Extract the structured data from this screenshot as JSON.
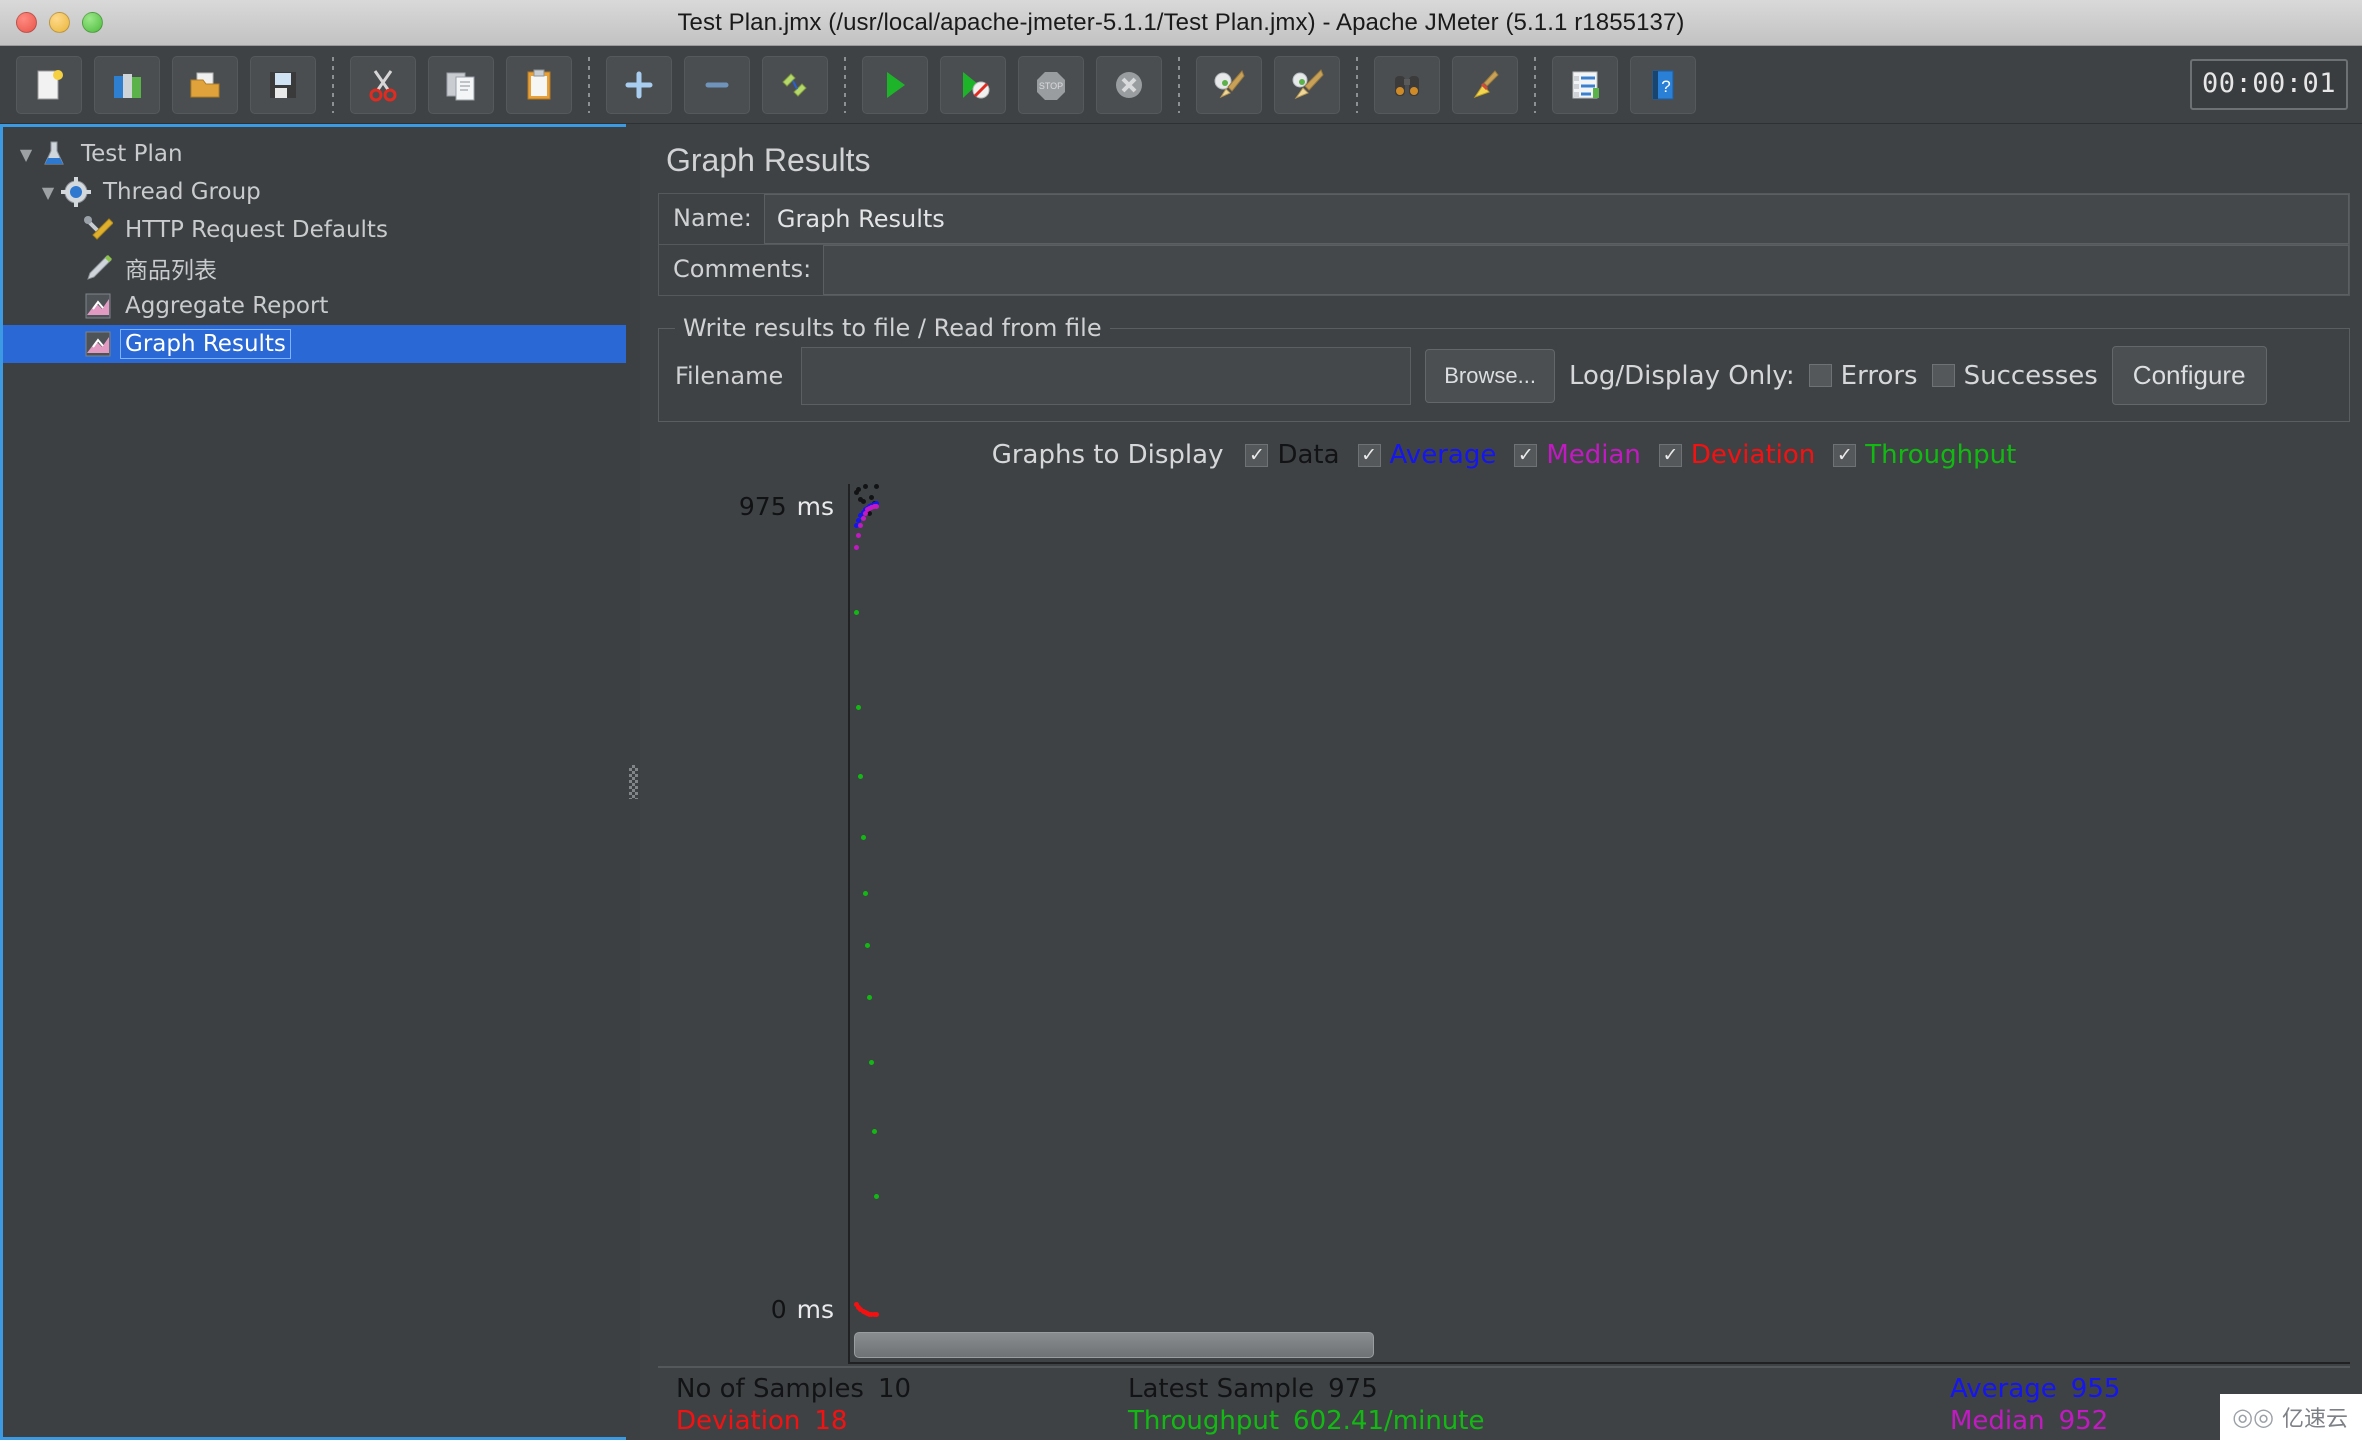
{
  "window": {
    "title": "Test Plan.jmx (/usr/local/apache-jmeter-5.1.1/Test Plan.jmx) - Apache JMeter (5.1.1 r1855137)",
    "traffic_lights": [
      "close-button",
      "minimize-button",
      "zoom-button"
    ]
  },
  "toolbar": {
    "buttons": [
      {
        "name": "new-test-plan",
        "icon": "new-document-icon",
        "glyph": "🗎"
      },
      {
        "name": "templates",
        "icon": "templates-icon",
        "glyph": "📚"
      },
      {
        "name": "open",
        "icon": "open-folder-icon",
        "glyph": "📂"
      },
      {
        "name": "save",
        "icon": "floppy-disk-icon",
        "glyph": "💾"
      },
      {
        "name": "cut",
        "icon": "scissors-icon",
        "glyph": "✂"
      },
      {
        "name": "copy",
        "icon": "copy-pages-icon",
        "glyph": "🗐"
      },
      {
        "name": "paste",
        "icon": "clipboard-icon",
        "glyph": "📋"
      },
      {
        "name": "expand-all",
        "icon": "plus-icon",
        "glyph": "＋"
      },
      {
        "name": "collapse-all",
        "icon": "minus-icon",
        "glyph": "−"
      },
      {
        "name": "toggle",
        "icon": "pencil-toggle-icon",
        "glyph": "✐"
      },
      {
        "name": "start",
        "icon": "play-green-icon",
        "glyph": "▶"
      },
      {
        "name": "start-no-pauses",
        "icon": "play-no-timers-icon",
        "glyph": "▶"
      },
      {
        "name": "stop",
        "icon": "stop-sign-icon",
        "glyph": "STOP"
      },
      {
        "name": "shutdown",
        "icon": "shutdown-x-icon",
        "glyph": "✕"
      },
      {
        "name": "clear",
        "icon": "broom-gear-icon",
        "glyph": "🧹"
      },
      {
        "name": "clear-all",
        "icon": "broom-gear-all-icon",
        "glyph": "🧹"
      },
      {
        "name": "search",
        "icon": "binoculars-icon",
        "glyph": "🔭"
      },
      {
        "name": "reset-search",
        "icon": "yellow-broom-icon",
        "glyph": "🧹"
      },
      {
        "name": "function-helper",
        "icon": "list-lines-icon",
        "glyph": "☰"
      },
      {
        "name": "help",
        "icon": "blue-question-book-icon",
        "glyph": "?"
      }
    ],
    "timer": "00:00:01"
  },
  "tree": {
    "items": [
      {
        "label": "Test Plan",
        "depth": 0,
        "twisty": "▼",
        "icon": "flask-icon",
        "selected": false
      },
      {
        "label": "Thread Group",
        "depth": 1,
        "twisty": "▼",
        "icon": "gear-icon",
        "selected": false
      },
      {
        "label": "HTTP Request Defaults",
        "depth": 2,
        "twisty": "",
        "icon": "tools-icon",
        "selected": false
      },
      {
        "label": "商品列表",
        "depth": 2,
        "twisty": "",
        "icon": "pencil-icon",
        "selected": false
      },
      {
        "label": "Aggregate Report",
        "depth": 2,
        "twisty": "",
        "icon": "chart-icon",
        "selected": false
      },
      {
        "label": "Graph Results",
        "depth": 2,
        "twisty": "",
        "icon": "chart-icon",
        "selected": true
      }
    ]
  },
  "panel": {
    "title": "Graph Results",
    "name_label": "Name:",
    "name_value": "Graph Results",
    "comments_label": "Comments:",
    "comments_value": "",
    "file_group_legend": "Write results to file / Read from file",
    "filename_label": "Filename",
    "filename_value": "",
    "browse_label": "Browse...",
    "log_display_label": "Log/Display Only:",
    "errors_label": "Errors",
    "errors_checked": false,
    "successes_label": "Successes",
    "successes_checked": false,
    "configure_label": "Configure"
  },
  "graphs_to_display": {
    "lead_label": "Graphs to Display",
    "options": [
      {
        "label": "Data",
        "checked": true,
        "color": "#121315"
      },
      {
        "label": "Average",
        "checked": true,
        "color": "#1515ef"
      },
      {
        "label": "Median",
        "checked": true,
        "color": "#c21ac2"
      },
      {
        "label": "Deviation",
        "checked": true,
        "color": "#f51111"
      },
      {
        "label": "Throughput",
        "checked": true,
        "color": "#13b913"
      }
    ]
  },
  "chart_data": {
    "type": "scatter",
    "title": "Graph Results",
    "xlabel": "",
    "ylabel": "ms",
    "ylim": [
      0,
      975
    ],
    "y_ticks": [
      {
        "value": 975,
        "label": "975",
        "unit": "ms"
      },
      {
        "value": 0,
        "label": "0",
        "unit": "ms"
      }
    ],
    "grid": false,
    "legend_position": "top",
    "sample_count": 10,
    "series": [
      {
        "name": "Data",
        "color": "#121315",
        "x": [
          1,
          2,
          3,
          4,
          5,
          6,
          7,
          8,
          9,
          10
        ],
        "y": [
          968,
          972,
          960,
          958,
          975,
          950,
          944,
          962,
          955,
          975
        ]
      },
      {
        "name": "Average",
        "color": "#1515ef",
        "x": [
          1,
          2,
          3,
          4,
          5,
          6,
          7,
          8,
          9,
          10
        ],
        "y": [
          930,
          936,
          941,
          945,
          948,
          950,
          952,
          953,
          954,
          955
        ]
      },
      {
        "name": "Median",
        "color": "#c21ac2",
        "x": [
          1,
          2,
          3,
          4,
          5,
          6,
          7,
          8,
          9,
          10
        ],
        "y": [
          905,
          918,
          930,
          938,
          944,
          948,
          950,
          951,
          952,
          952
        ]
      },
      {
        "name": "Deviation",
        "color": "#f51111",
        "x": [
          1,
          2,
          3,
          4,
          5,
          6,
          7,
          8,
          9,
          10
        ],
        "y": [
          30,
          26,
          24,
          22,
          21,
          20,
          19,
          19,
          18,
          18
        ]
      },
      {
        "name": "Throughput",
        "color": "#13b913",
        "x": [
          1,
          2,
          3,
          4,
          5,
          6,
          7,
          8,
          9,
          10
        ],
        "y": [
          830,
          720,
          640,
          570,
          505,
          445,
          385,
          310,
          230,
          155
        ]
      }
    ]
  },
  "stats": {
    "rows": [
      [
        {
          "label": "No of Samples",
          "value": "10",
          "color": "#121315"
        },
        {
          "label": "Latest Sample",
          "value": "975",
          "color": "#121315"
        },
        {
          "label": "Average",
          "value": "955",
          "color": "#1515ef"
        }
      ],
      [
        {
          "label": "Deviation",
          "value": "18",
          "color": "#f51111"
        },
        {
          "label": "Throughput",
          "value": "602.41/minute",
          "color": "#13b913"
        },
        {
          "label": "Median",
          "value": "952",
          "color": "#c21ac2"
        }
      ]
    ]
  },
  "watermark": {
    "logo": "◎◎",
    "text": "亿速云"
  }
}
